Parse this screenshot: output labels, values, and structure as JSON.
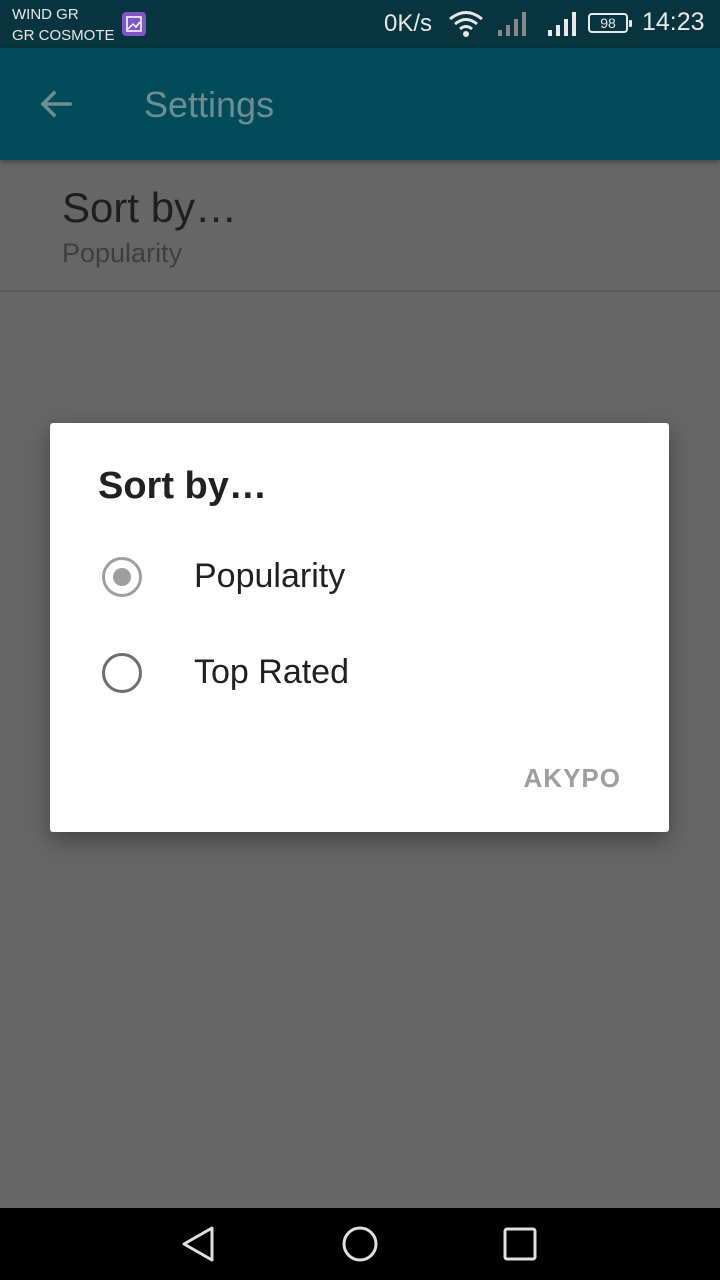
{
  "status_bar": {
    "carrier_line1": "WIND GR",
    "carrier_line2": "GR COSMOTE",
    "net_speed": "0K/s",
    "battery": "98",
    "time": "14:23"
  },
  "app_bar": {
    "title": "Settings",
    "color": "#024b59"
  },
  "preference": {
    "title": "Sort by…",
    "summary": "Popularity"
  },
  "dialog": {
    "title": "Sort by…",
    "options": [
      {
        "label": "Popularity",
        "selected": true
      },
      {
        "label": "Top Rated",
        "selected": false
      }
    ],
    "button": "AKYPO"
  },
  "icons": {
    "back": "arrow-left-icon",
    "gallery": "gallery-icon",
    "wifi": "wifi-icon",
    "signal": "signal-icon",
    "nav_back": "triangle-back-icon",
    "nav_home": "circle-home-icon",
    "nav_recent": "square-recents-icon"
  }
}
